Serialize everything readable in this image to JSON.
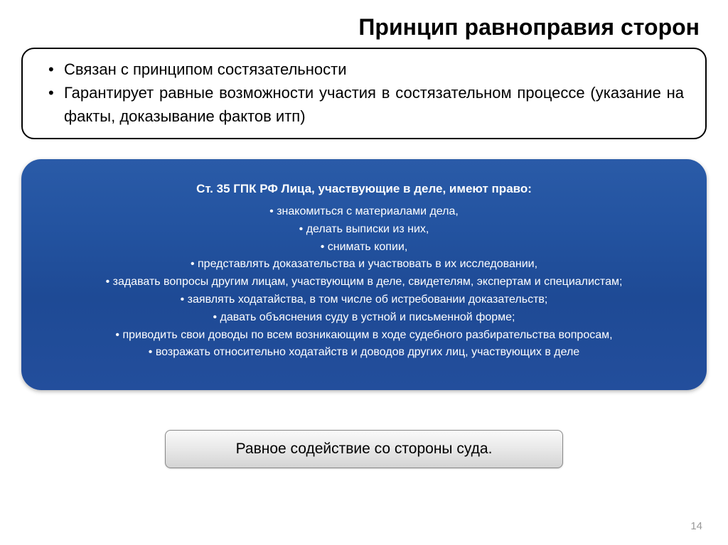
{
  "title": "Принцип равноправия сторон",
  "topBox": {
    "items": [
      "Связан с принципом состязательности",
      "Гарантирует равные возможности участия в состязательном процессе (указание на факты, доказывание фактов итп)"
    ]
  },
  "blueBox": {
    "heading": "Ст. 35 ГПК РФ Лица, участвующие в деле, имеют право:",
    "items": [
      "знакомиться с материалами дела,",
      "делать выписки из них,",
      "снимать копии,",
      "представлять доказательства и участвовать в их исследовании,",
      "задавать вопросы другим лицам, участвующим в деле, свидетелям, экспертам и специалистам;",
      "заявлять ходатайства, в том числе об истребовании доказательств;",
      "давать объяснения суду в устной и письменной форме;",
      "приводить свои доводы по всем возникающим в ходе судебного разбирательства вопросам,",
      "возражать относительно ходатайств и доводов других лиц, участвующих в деле"
    ]
  },
  "footerBox": "Равное содействие со стороны суда.",
  "pageNumber": "14"
}
